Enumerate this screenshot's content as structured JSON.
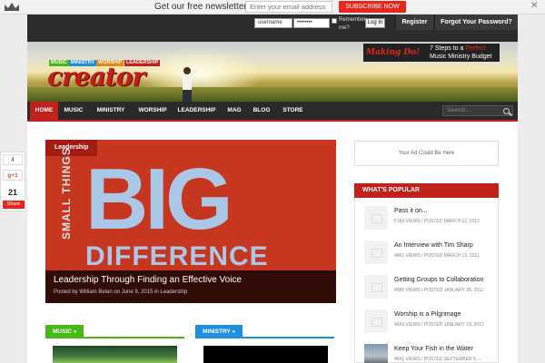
{
  "newsletter": {
    "text": "Get our free newsletters",
    "email_placeholder": "Enter your email address",
    "subscribe_label": "SUBSCRIBE NOW",
    "close_label": "✕"
  },
  "login": {
    "username_value": "username",
    "password_value": "••••••••",
    "remember_label": "Remember me?",
    "login_label": "Log In",
    "register_label": "Register",
    "forgot_label": "Forgot Your Password?"
  },
  "banner": {
    "tags": [
      "MUSIC",
      "MINISTRY",
      "WORSHIP",
      "LEADERSHIP"
    ],
    "logo_text": "creator",
    "ad_brand": "Making Do!",
    "ad_text_1": "7 Steps to a ",
    "ad_text_highlight": "Perfect",
    "ad_text_2": "Music Ministry Budget"
  },
  "nav": {
    "items": [
      "HOME",
      "MUSIC",
      "MINISTRY",
      "WORSHIP",
      "LEADERSHIP",
      "MAG",
      "BLOG",
      "STORE"
    ],
    "active": "HOME",
    "search_placeholder": "Search..."
  },
  "share": {
    "count_1": "4",
    "gplus_label": "g+1",
    "total": "21",
    "share_label": "Share"
  },
  "feature": {
    "category": "Leadership",
    "image_side_text": "SMALL THINGS",
    "image_big_text": "BIG",
    "image_bottom_text": "DIFFERENCE",
    "title": "Leadership Through Finding an Effective Voice",
    "meta": "Posted by William Belan on June 9, 2015 in Leadership"
  },
  "categories": [
    {
      "label": "MUSIC »",
      "color": "#46b818"
    },
    {
      "label": "MINISTRY »",
      "color": "#1e8fdc"
    }
  ],
  "sidebar": {
    "ad_text": "Your Ad Could Be Here",
    "popular_title": "WHAT'S POPULAR",
    "popular": [
      {
        "title": "Pass it on...",
        "meta": "5184 VIEWS / POSTED MARCH 12, 2012"
      },
      {
        "title": "An Interview with Tim Sharp",
        "meta": "4861 VIEWS / POSTED MARCH 13, 2011"
      },
      {
        "title": "Getting Groups to Collaboration",
        "meta": "4685 VIEWS / POSTED JANUARY 28, 2011"
      },
      {
        "title": "Worship is a Pilgrimage",
        "meta": "4643 VIEWS / POSTED JANUARY 18, 2012"
      },
      {
        "title": "Keep Your Fish in the Water",
        "meta": "4641 VIEWS / POSTED SEPTEMBER 5, ..."
      }
    ]
  },
  "colors": {
    "brand_red": "#c0211a",
    "subscribe_red": "#e8261c",
    "music_green": "#46b818",
    "ministry_blue": "#1e8fdc"
  }
}
